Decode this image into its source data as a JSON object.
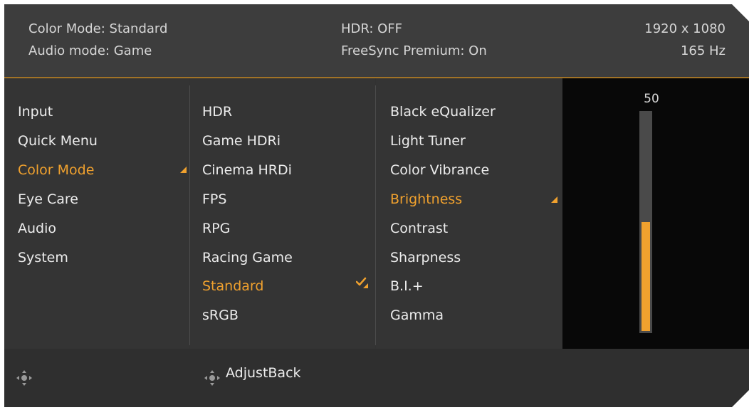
{
  "info": {
    "color_mode": "Color Mode: Standard",
    "audio_mode": "Audio mode: Game",
    "hdr": "HDR: OFF",
    "freesync": "FreeSync Premium: On",
    "resolution": "1920 x 1080",
    "refresh": "165 Hz"
  },
  "menu": {
    "main": [
      "Input",
      "Quick Menu",
      "Color Mode",
      "Eye Care",
      "Audio",
      "System"
    ],
    "main_selected": "Color Mode",
    "color_modes": [
      "HDR",
      "Game HDRi",
      "Cinema HRDi",
      "FPS",
      "RPG",
      "Racing Game",
      "Standard",
      "sRGB"
    ],
    "color_mode_selected": "Standard",
    "settings": [
      "Black eQualizer",
      "Light Tuner",
      "Color Vibrance",
      "Brightness",
      "Contrast",
      "Sharpness",
      "B.I.+",
      "Gamma"
    ],
    "setting_selected": "Brightness"
  },
  "slider": {
    "value": "50",
    "level": 0.5
  },
  "footer": {
    "label": "AdjustBack",
    "icons": [
      "joystick-icon",
      "joystick-icon"
    ]
  },
  "colors": {
    "accent": "#f0a12e",
    "panel": "#343434",
    "header": "#3d3d3d",
    "slider_panel": "#080808"
  }
}
